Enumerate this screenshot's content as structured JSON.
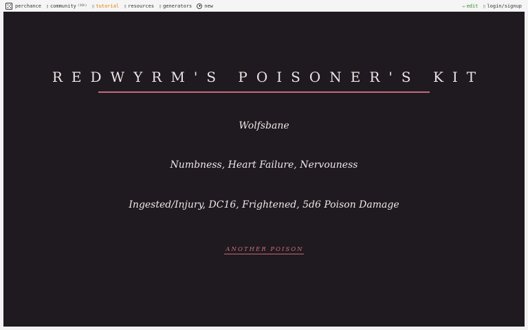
{
  "topbar": {
    "brand": "perchance",
    "community_label": "community",
    "community_count": "(16h)",
    "tutorial_label": "tutorial",
    "resources_label": "resources",
    "generators_label": "generators",
    "new_label": "new",
    "edit_label": "edit",
    "login_label": "login/signup",
    "accent_orange": "#e07b00",
    "accent_green": "#2e8b2e"
  },
  "main": {
    "title": "REDWYRM'S POISONER'S KIT",
    "poison_name": "Wolfsbane",
    "effects": "Numbness, Heart Failure, Nervouness",
    "details": "Ingested/Injury, DC16, Frightened, 5d6 Poison Damage",
    "another_button": "ANOTHER POISON",
    "background": "#1f1a1f",
    "accent": "#c86a78"
  }
}
